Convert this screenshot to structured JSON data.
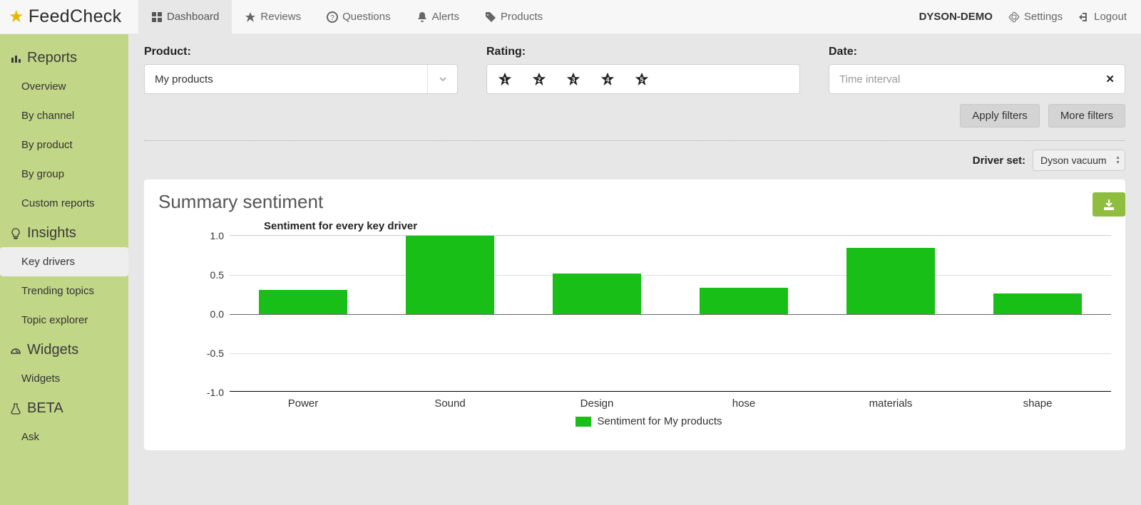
{
  "app": {
    "name": "FeedCheck"
  },
  "topnav": [
    {
      "label": "Dashboard",
      "icon": "grid"
    },
    {
      "label": "Reviews",
      "icon": "star"
    },
    {
      "label": "Questions",
      "icon": "help"
    },
    {
      "label": "Alerts",
      "icon": "bell"
    },
    {
      "label": "Products",
      "icon": "tag"
    }
  ],
  "user": {
    "name": "DYSON-DEMO"
  },
  "topright": {
    "settings": "Settings",
    "logout": "Logout"
  },
  "sidebar": {
    "section1": {
      "title": "Reports",
      "items": [
        "Overview",
        "By channel",
        "By product",
        "By group",
        "Custom reports"
      ]
    },
    "section2": {
      "title": "Insights",
      "items": [
        "Key drivers",
        "Trending topics",
        "Topic explorer"
      ],
      "active_index": 0
    },
    "section3": {
      "title": "Widgets",
      "items": [
        "Widgets"
      ]
    },
    "section4": {
      "title": "BETA",
      "items": [
        "Ask"
      ]
    }
  },
  "filters": {
    "product": {
      "label": "Product:",
      "value": "My products"
    },
    "rating": {
      "label": "Rating:",
      "stars": [
        "1",
        "2",
        "3",
        "4",
        "5"
      ]
    },
    "date": {
      "label": "Date:",
      "placeholder": "Time interval"
    },
    "apply": "Apply filters",
    "more": "More filters"
  },
  "driver_set": {
    "label": "Driver set:",
    "value": "Dyson vacuum"
  },
  "panel": {
    "title": "Summary sentiment"
  },
  "chart_data": {
    "type": "bar",
    "title": "Sentiment for every key driver",
    "categories": [
      "Power",
      "Sound",
      "Design",
      "hose",
      "materials",
      "shape"
    ],
    "series": [
      {
        "name": "Sentiment for My products",
        "values": [
          0.31,
          1.0,
          0.52,
          0.34,
          0.85,
          0.26
        ]
      }
    ],
    "ylim": [
      -1.0,
      1.0
    ],
    "yticks": [
      -1.0,
      -0.5,
      0.0,
      0.5,
      1.0
    ],
    "color": "#17bf17"
  }
}
